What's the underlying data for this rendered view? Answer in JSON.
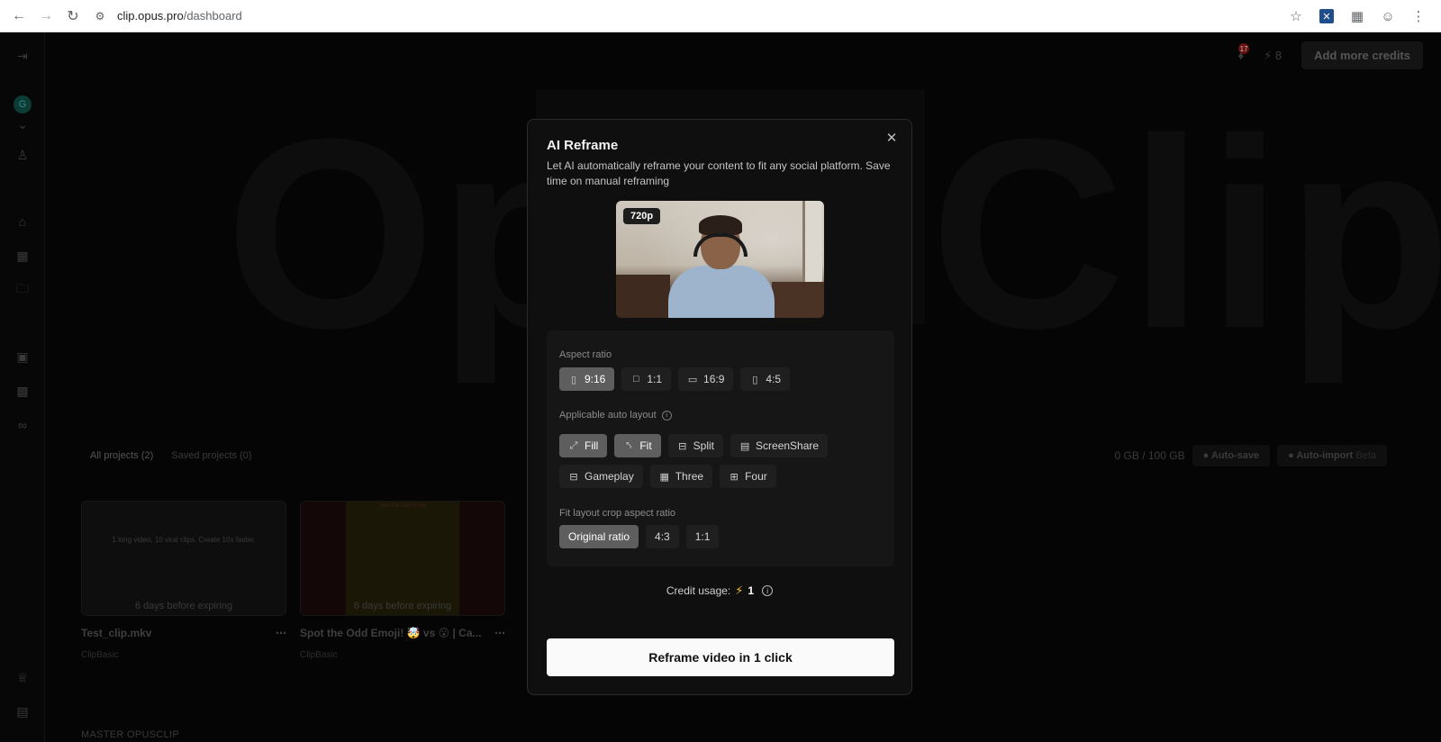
{
  "browser": {
    "url_host": "clip.opus.pro",
    "url_path": "/dashboard"
  },
  "app": {
    "avatar_letter": "G",
    "bg_brand_text": "OpusClip",
    "notification_count": "17",
    "credits_count": "8",
    "add_credits_label": "Add more credits",
    "tabs": [
      "All projects (2)",
      "Saved projects (0)"
    ],
    "storage": "0 GB / 100 GB",
    "auto_save": "Auto-save",
    "auto_import": "Auto-import",
    "beta": "Beta",
    "projects": [
      {
        "title": "Test_clip.mkv",
        "sub": "ClipBasic",
        "expiry": "6 days before expiring",
        "thumb_text": "1 long video, 10 viral clips. Create 10x faster."
      },
      {
        "title": "Spot the Odd Emoji! 🤯 vs 😮 | Ca...",
        "sub": "ClipBasic",
        "expiry": "6 days before expiring",
        "thumb_text": "Spot the Odd Emoji"
      }
    ],
    "section_label": "MASTER OPUSCLIP"
  },
  "modal": {
    "title": "AI Reframe",
    "description": "Let AI automatically reframe your content to fit any social platform. Save time on manual reframing",
    "resolution": "720p",
    "aspect_label": "Aspect ratio",
    "aspect_options": [
      "9:16",
      "1:1",
      "16:9",
      "4:5"
    ],
    "aspect_selected": "9:16",
    "layout_label": "Applicable auto layout",
    "layout_options": [
      "Fill",
      "Fit",
      "Split",
      "ScreenShare",
      "Gameplay",
      "Three",
      "Four"
    ],
    "layout_selected": [
      "Fill",
      "Fit"
    ],
    "crop_label": "Fit layout crop aspect ratio",
    "crop_options": [
      "Original ratio",
      "4:3",
      "1:1"
    ],
    "crop_selected": "Original ratio",
    "credit_label": "Credit usage:",
    "credit_value": "1",
    "cta_label": "Reframe video in 1 click"
  },
  "colors": {
    "modal_bg": "#0f0f0f",
    "selected_chip": "#5e5e5e",
    "credit_bolt": "#f2c230",
    "cta_bg": "#fafafa"
  }
}
